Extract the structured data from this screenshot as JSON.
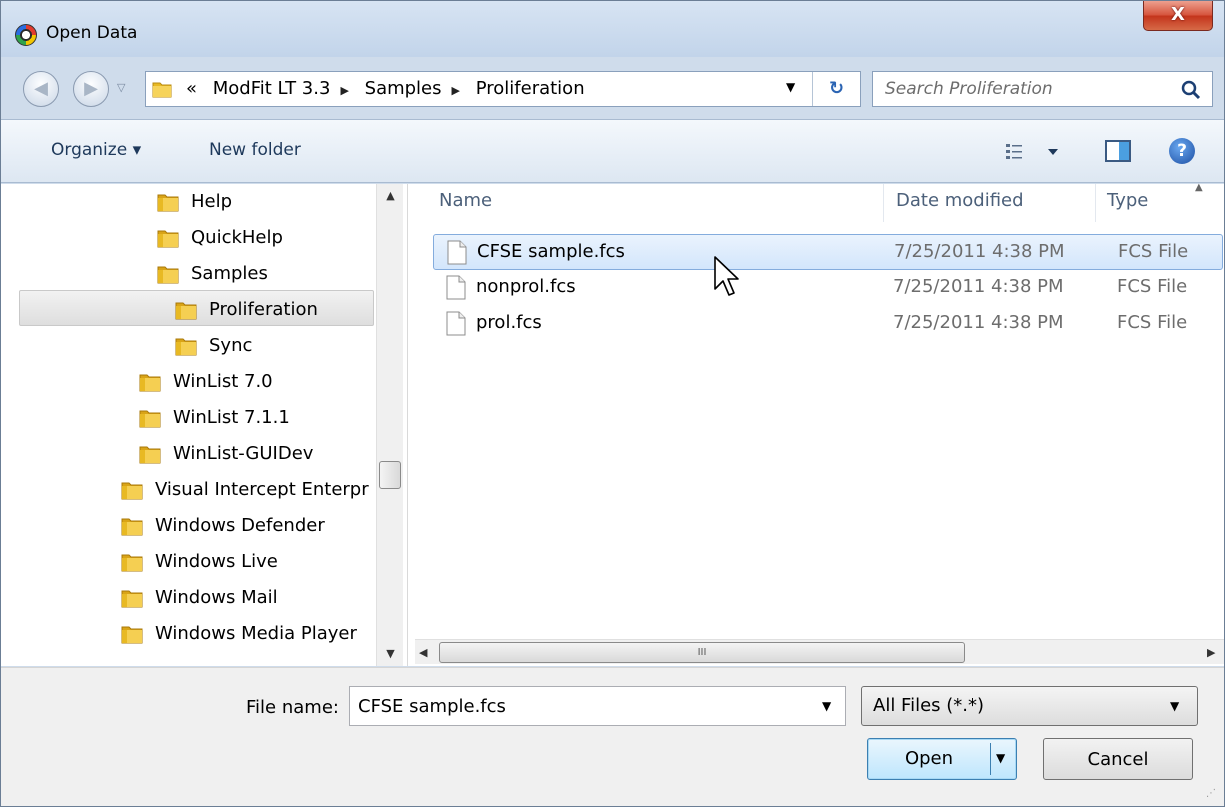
{
  "window": {
    "title": "Open Data",
    "close_label": "X"
  },
  "address": {
    "crumbs": [
      "«",
      "ModFit LT 3.3",
      "Samples",
      "Proliferation"
    ]
  },
  "search": {
    "placeholder": "Search Proliferation"
  },
  "toolbar": {
    "organize_label": "Organize ▾",
    "new_folder_label": "New folder",
    "help_label": "?"
  },
  "tree": [
    {
      "label": "Help"
    },
    {
      "label": "QuickHelp"
    },
    {
      "label": "Samples"
    },
    {
      "label": "Proliferation"
    },
    {
      "label": "Sync"
    },
    {
      "label": "WinList 7.0"
    },
    {
      "label": "WinList 7.1.1"
    },
    {
      "label": "WinList-GUIDev"
    },
    {
      "label": "Visual Intercept Enterpr"
    },
    {
      "label": "Windows Defender"
    },
    {
      "label": "Windows Live"
    },
    {
      "label": "Windows Mail"
    },
    {
      "label": "Windows Media Player"
    }
  ],
  "columns": {
    "name": "Name",
    "date": "Date modified",
    "type": "Type"
  },
  "files": [
    {
      "name": "CFSE sample.fcs",
      "date": "7/25/2011 4:38 PM",
      "type": "FCS File"
    },
    {
      "name": "nonprol.fcs",
      "date": "7/25/2011 4:38 PM",
      "type": "FCS File"
    },
    {
      "name": "prol.fcs",
      "date": "7/25/2011 4:38 PM",
      "type": "FCS File"
    }
  ],
  "hscroll_grip": "III",
  "bottom": {
    "file_name_label": "File name:",
    "file_name_value": "CFSE sample.fcs",
    "filter_value": "All Files (*.*)",
    "open_label": "Open",
    "cancel_label": "Cancel"
  },
  "colors": {
    "selection": "#d3e6fc",
    "selection_border": "#84acdd",
    "folder": "#e8b923"
  }
}
